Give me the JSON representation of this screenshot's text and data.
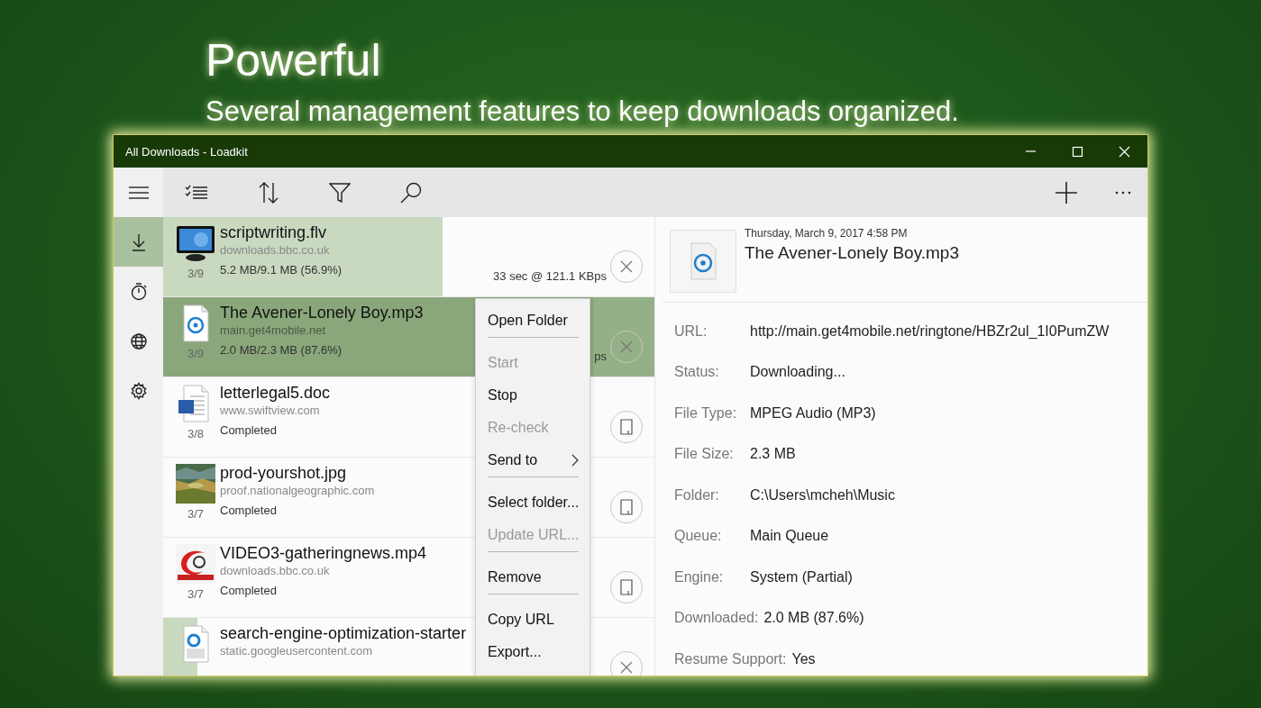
{
  "hero": {
    "title": "Powerful",
    "subtitle": "Several management features to keep downloads organized."
  },
  "window": {
    "title": "All Downloads - Loadkit"
  },
  "nav": [
    {
      "kind": "download",
      "selected": true
    },
    {
      "kind": "timer",
      "selected": false
    },
    {
      "kind": "globe",
      "selected": false
    },
    {
      "kind": "settings",
      "selected": false
    }
  ],
  "downloads": [
    {
      "kind": "video",
      "name": "scriptwriting.flv",
      "source": "downloads.bbc.co.uk",
      "position": "3/9",
      "progress": "5.2 MB/9.1 MB (56.9%)",
      "speed": "33 sec @ 121.1 KBps",
      "level": 0.569,
      "selected": false,
      "completed": false
    },
    {
      "kind": "audio",
      "name": "The Avener-Lonely Boy.mp3",
      "source": "main.get4mobile.net",
      "position": "3/9",
      "progress": "2.0 MB/2.3 MB (87.6%)",
      "speed": "ps",
      "level": 0.876,
      "selected": true,
      "completed": false
    },
    {
      "kind": "document",
      "name": "letterlegal5.doc",
      "source": "www.swiftview.com",
      "position": "3/8",
      "progress": "Completed",
      "selected": false,
      "completed": true
    },
    {
      "name": "prod-yourshot.jpg",
      "source": "proof.nationalgeographic.com",
      "position": "3/7",
      "progress": "Completed",
      "selected": false,
      "completed": true
    },
    {
      "kind": "swirl",
      "name": "VIDEO3-gatheringnews.mp4",
      "source": "downloads.bbc.co.uk",
      "position": "3/7",
      "progress": "Completed",
      "selected": false,
      "completed": true
    },
    {
      "kind": "web",
      "name": "search-engine-optimization-starter",
      "source": "static.googleusercontent.com",
      "level": 0.07,
      "selected": false,
      "completed": false
    }
  ],
  "menu": [
    {
      "kind": "item",
      "label": "Open Folder",
      "disabled": false,
      "submenu": false
    },
    {
      "kind": "separator"
    },
    {
      "kind": "item",
      "label": "Start",
      "disabled": true,
      "submenu": false
    },
    {
      "kind": "item",
      "label": "Stop",
      "disabled": false,
      "submenu": false
    },
    {
      "kind": "item",
      "label": "Re-check",
      "disabled": true,
      "submenu": false
    },
    {
      "kind": "item",
      "label": "Send to",
      "disabled": false,
      "submenu": true
    },
    {
      "kind": "separator"
    },
    {
      "kind": "item",
      "label": "Select folder...",
      "disabled": false,
      "submenu": false
    },
    {
      "kind": "item",
      "label": "Update URL...",
      "disabled": true,
      "submenu": false
    },
    {
      "kind": "separator"
    },
    {
      "kind": "item",
      "label": "Remove",
      "disabled": false,
      "submenu": false
    },
    {
      "kind": "separator"
    },
    {
      "kind": "item",
      "label": "Copy URL",
      "disabled": false,
      "submenu": false
    },
    {
      "kind": "item",
      "label": "Export...",
      "disabled": false,
      "submenu": false
    }
  ],
  "details": {
    "date": "Thursday, March 9, 2017 4:58 PM",
    "title": "The Avener-Lonely Boy.mp3",
    "fields": [
      {
        "label": "URL:",
        "value": "http://main.get4mobile.net/ringtone/HBZr2ul_1I0PumZW"
      },
      {
        "label": "Status:",
        "value": "Downloading..."
      },
      {
        "label": "File Type:",
        "value": "MPEG Audio (MP3)"
      },
      {
        "label": "File Size:",
        "value": "2.3 MB"
      },
      {
        "label": "Folder:",
        "value": "C:\\Users\\mcheh\\Music"
      },
      {
        "label": "Queue:",
        "value": "Main Queue"
      },
      {
        "label": "Engine:",
        "value": "System (Partial)"
      },
      {
        "label": "Downloaded:",
        "value": "2.0 MB (87.6%)"
      },
      {
        "label": "Resume Support:",
        "value": "Yes"
      }
    ]
  }
}
